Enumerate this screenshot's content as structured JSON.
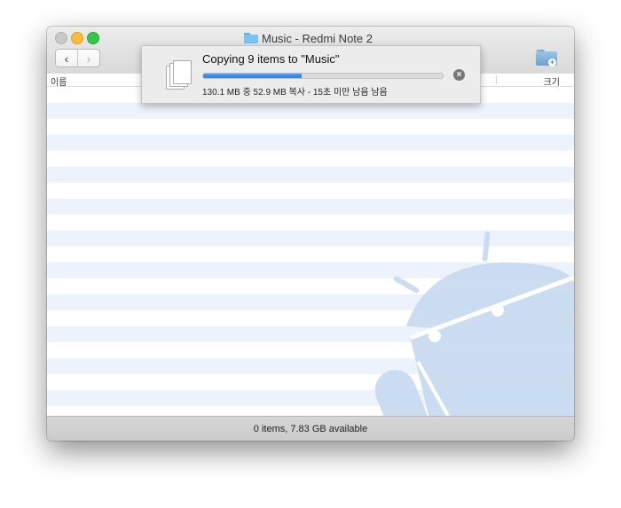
{
  "window": {
    "title": "Music - Redmi Note 2",
    "folder_icon": "folder-icon"
  },
  "toolbar": {
    "back_glyph": "‹",
    "forward_glyph": "›",
    "new_folder_icon": "new-folder-icon"
  },
  "columns": {
    "name": "이름",
    "size": "크기"
  },
  "copy_dialog": {
    "title": "Copying 9 items to \"Music\"",
    "progress_fraction": 0.41,
    "detail": "130.1 MB 중 52.9 MB 복사 - 15초 미만 남음 남음",
    "icon": "documents-icon",
    "stop_glyph": "×"
  },
  "status": {
    "text": "0 items, 7.83 GB available"
  },
  "colors": {
    "stripe": "#edf3fc",
    "android_watermark": "#c7daf1",
    "progress": "#3b8ae9"
  }
}
